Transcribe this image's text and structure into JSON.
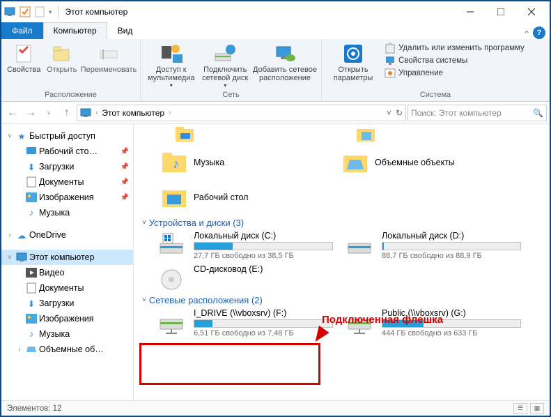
{
  "title": "Этот компьютер",
  "tabs": {
    "file": "Файл",
    "computer": "Компьютер",
    "view": "Вид"
  },
  "ribbon": {
    "location": {
      "label": "Расположение",
      "props": "Свойства",
      "open": "Открыть",
      "rename": "Переименовать"
    },
    "network": {
      "label": "Сеть",
      "media": "Доступ к мультимедиа",
      "mapdrive": "Подключить сетевой диск",
      "addnet": "Добавить сетевое расположение"
    },
    "system": {
      "label": "Система",
      "settings": "Открыть параметры",
      "uninstall": "Удалить или изменить программу",
      "sysprops": "Свойства системы",
      "manage": "Управление"
    }
  },
  "breadcrumb": "Этот компьютер",
  "search_placeholder": "Поиск: Этот компьютер",
  "sidebar": {
    "quick": {
      "label": "Быстрый доступ",
      "items": [
        "Рабочий сто…",
        "Загрузки",
        "Документы",
        "Изображения",
        "Музыка"
      ]
    },
    "onedrive": "OneDrive",
    "thispc": {
      "label": "Этот компьютер",
      "items": [
        "Видео",
        "Документы",
        "Загрузки",
        "Изображения",
        "Музыка",
        "Объемные об…"
      ]
    }
  },
  "folders": [
    "Музыка",
    "Объемные объекты",
    "Рабочий стол"
  ],
  "groups": {
    "drives": "Устройства и диски (3)",
    "netloc": "Сетевые расположения (2)"
  },
  "drives": [
    {
      "name": "Локальный диск (C:)",
      "free": "27,7 ГБ свободно из 38,5 ГБ",
      "pct": 28
    },
    {
      "name": "Локальный диск (D:)",
      "free": "88,7 ГБ свободно из 88,9 ГБ",
      "pct": 1
    },
    {
      "name": "CD-дисковод (E:)",
      "free": "",
      "pct": -1
    }
  ],
  "netdrives": [
    {
      "name": "I_DRIVE (\\\\vboxsrv) (F:)",
      "free": "6,51 ГБ свободно из 7,48 ГБ",
      "pct": 13
    },
    {
      "name": "Public (\\\\vboxsrv) (G:)",
      "free": "444 ГБ свободно из 633 ГБ",
      "pct": 30
    }
  ],
  "annotation": "Подключенная флешка",
  "status": "Элементов: 12"
}
